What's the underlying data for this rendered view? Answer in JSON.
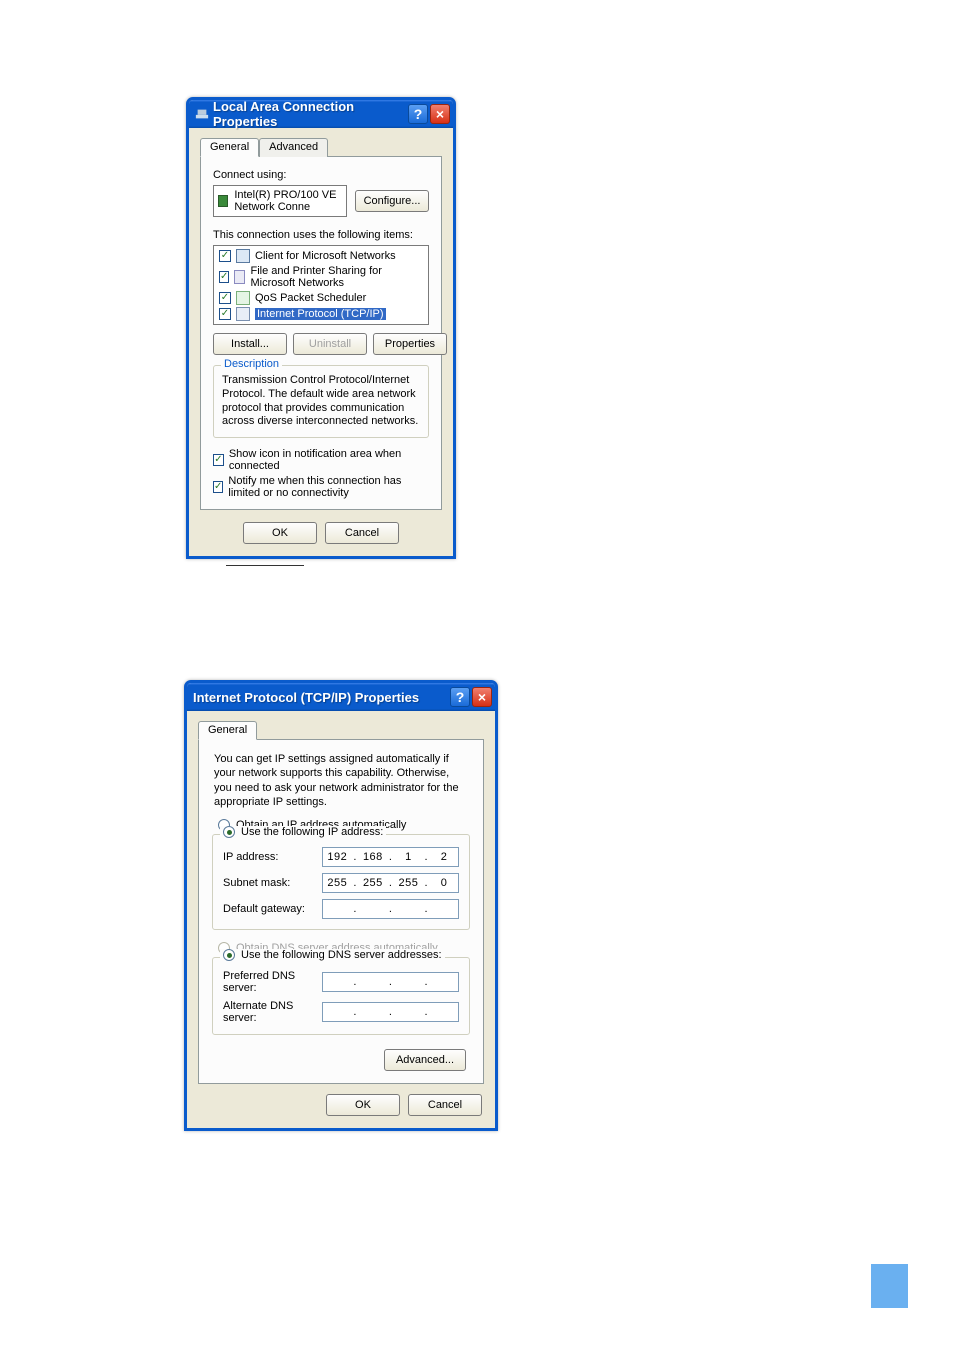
{
  "dialog1": {
    "title": "Local Area Connection Properties",
    "tabs": {
      "general": "General",
      "advanced": "Advanced"
    },
    "connect_using": "Connect using:",
    "adapter": "Intel(R) PRO/100 VE Network Conne",
    "configure": "Configure...",
    "uses_items": "This connection uses the following items:",
    "items": [
      {
        "text": "Client for Microsoft Networks"
      },
      {
        "text": "File and Printer Sharing for Microsoft Networks"
      },
      {
        "text": "QoS Packet Scheduler"
      },
      {
        "text": "Internet Protocol (TCP/IP)"
      }
    ],
    "install": "Install...",
    "uninstall": "Uninstall",
    "properties": "Properties",
    "description_label": "Description",
    "description_text": "Transmission Control Protocol/Internet Protocol. The default wide area network protocol that provides communication across diverse interconnected networks.",
    "show_icon": "Show icon in notification area when connected",
    "notify": "Notify me when this connection has limited or no connectivity",
    "ok": "OK",
    "cancel": "Cancel"
  },
  "dialog2": {
    "title": "Internet Protocol (TCP/IP) Properties",
    "tab": "General",
    "intro": "You can get IP settings assigned automatically if your network supports this capability. Otherwise, you need to ask your network administrator for the appropriate IP settings.",
    "radio_auto_ip": "Obtain an IP address automatically",
    "radio_use_ip": "Use the following IP address:",
    "ip_label": "IP address:",
    "ip_value": [
      "192",
      "168",
      "1",
      "2"
    ],
    "subnet_label": "Subnet mask:",
    "subnet_value": [
      "255",
      "255",
      "255",
      "0"
    ],
    "gateway_label": "Default gateway:",
    "gateway_value": [
      "",
      "",
      "",
      ""
    ],
    "radio_auto_dns": "Obtain DNS server address automatically",
    "radio_use_dns": "Use the following DNS server addresses:",
    "pref_dns_label": "Preferred DNS server:",
    "pref_dns_value": [
      "",
      "",
      "",
      ""
    ],
    "alt_dns_label": "Alternate DNS server:",
    "alt_dns_value": [
      "",
      "",
      "",
      ""
    ],
    "advanced": "Advanced...",
    "ok": "OK",
    "cancel": "Cancel"
  }
}
